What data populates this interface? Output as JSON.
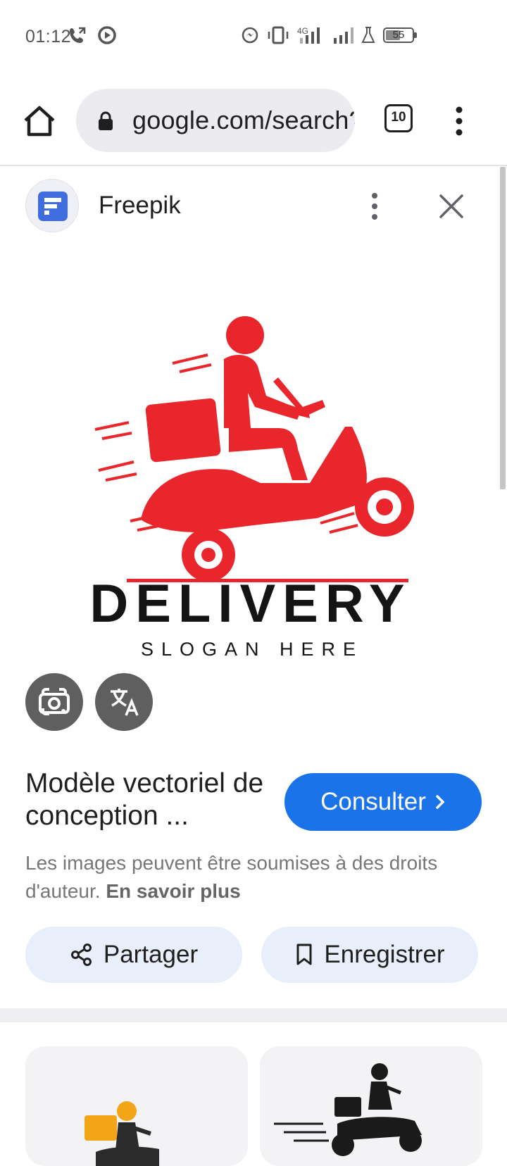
{
  "status_bar": {
    "time": "01:12",
    "icons": [
      "call-forward-icon",
      "screen-record-icon",
      "messenger-icon",
      "vibrate-icon",
      "signal-4g-icon",
      "signal-icon",
      "lab-icon"
    ],
    "network_label": "4G",
    "battery_level": 55,
    "battery_text": "55"
  },
  "browser": {
    "url": "google.com/search?",
    "tab_count": "10"
  },
  "source": {
    "name": "Freepik"
  },
  "hero_image": {
    "logo_main_text": "DELIVERY",
    "logo_sub_text": "SLOGAN HERE",
    "brand_color": "#e8262b"
  },
  "result": {
    "title": "Modèle vectoriel de conception ...",
    "consult_label": "Consulter",
    "copyright_text": "Les images peuvent être soumises à des droits d'auteur.",
    "learn_more_label": "En savoir plus",
    "share_label": "Partager",
    "save_label": "Enregistrer"
  },
  "colors": {
    "accent": "#1a73e8",
    "chip_bg": "#e8eefa",
    "round_button_bg": "#5f5f5f"
  }
}
